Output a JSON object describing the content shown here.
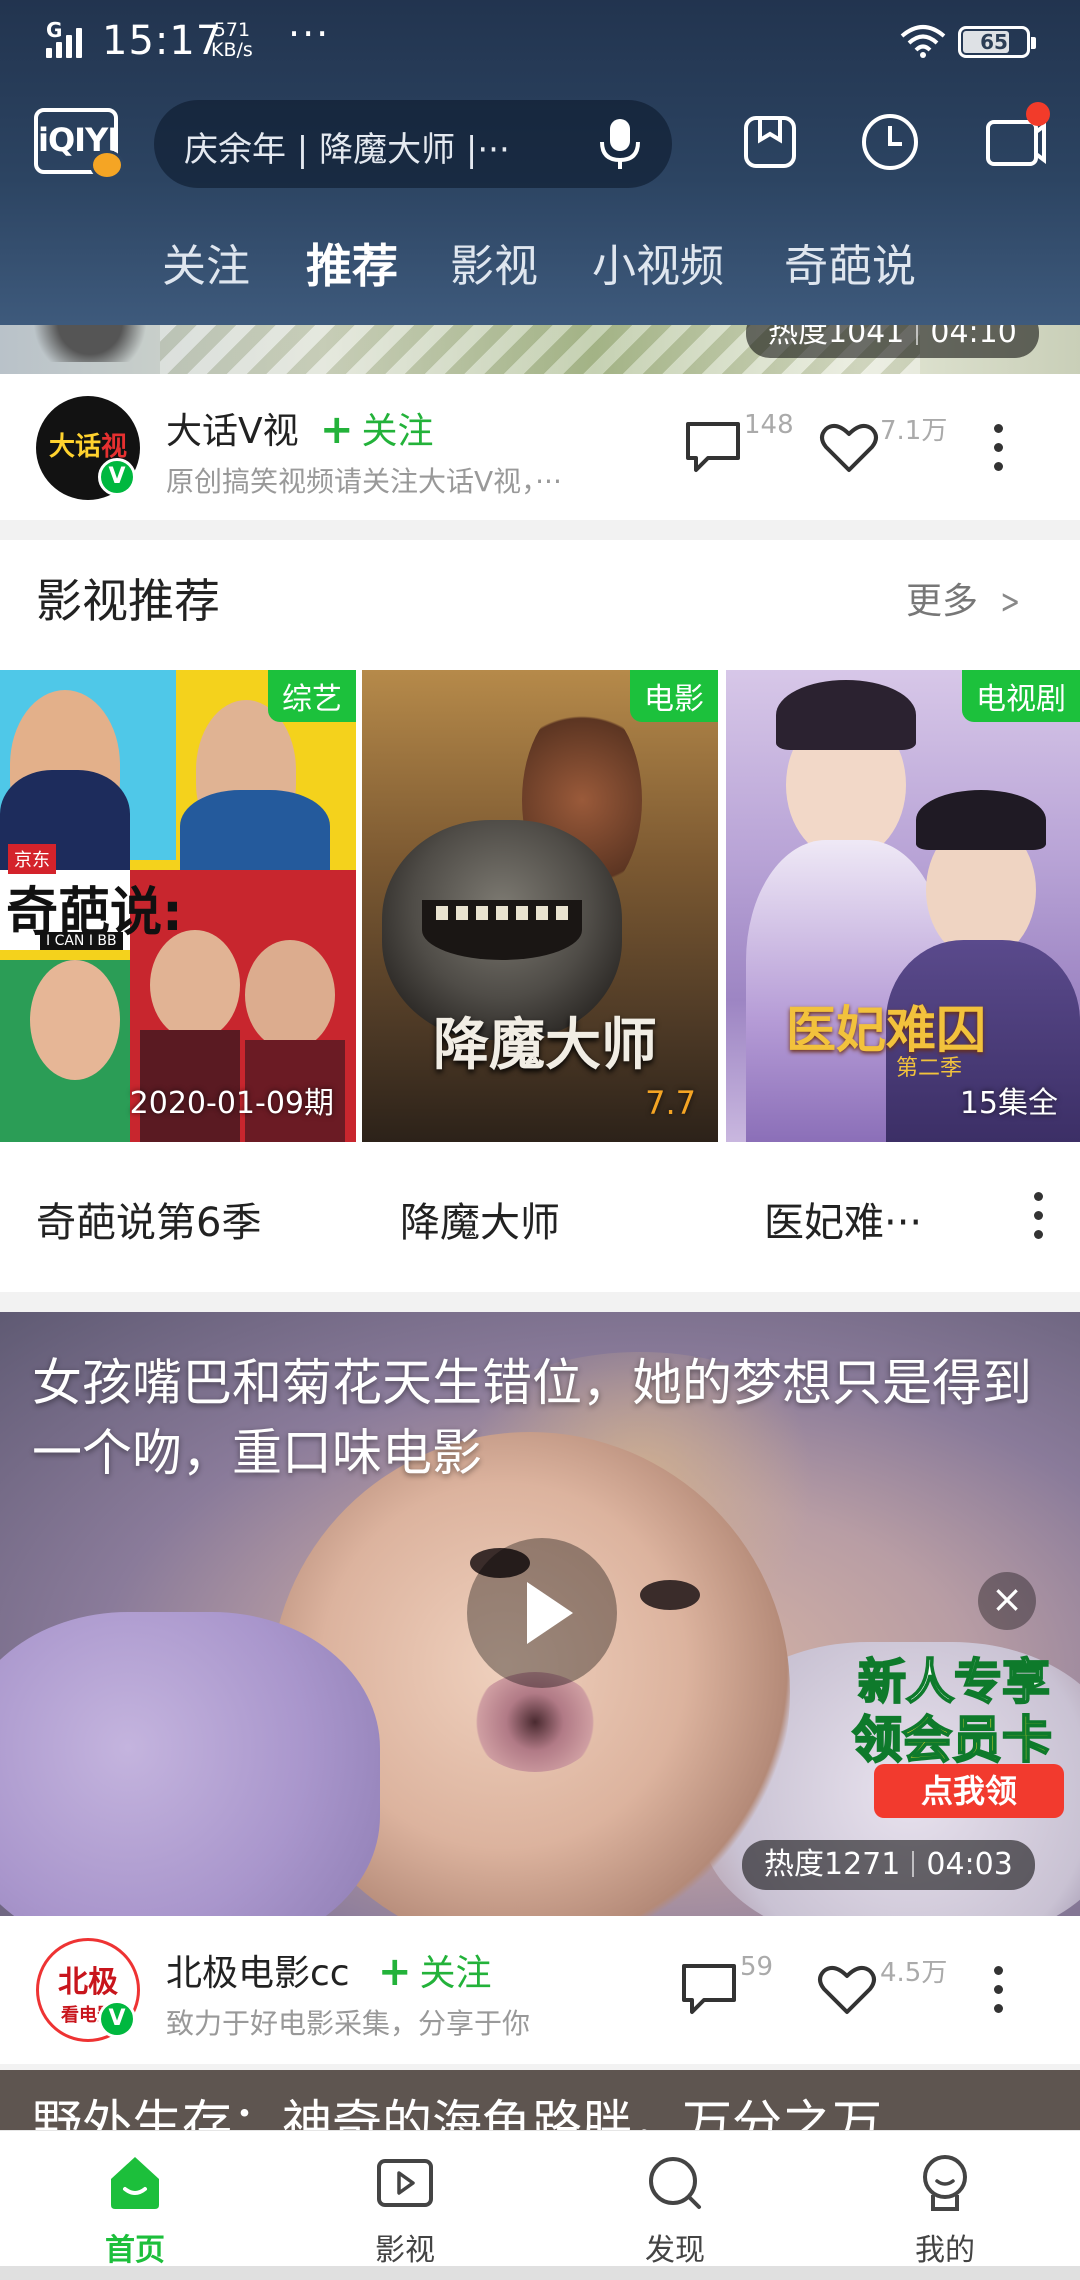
{
  "status_bar": {
    "network": "G",
    "time": "15:17",
    "speed_value": "571",
    "speed_unit": "KB/s",
    "more": "···",
    "battery": "65"
  },
  "header": {
    "logo": "iQIYI",
    "search_placeholder": "庆余年 | 降魔大师 |···",
    "icons": [
      "mic-icon",
      "bookmark-box-icon",
      "history-clock-icon",
      "message-icon"
    ],
    "tabs": [
      "关注",
      "推荐",
      "影视",
      "小视频",
      "奇葩说"
    ],
    "active_tab": "推荐"
  },
  "prev_video": {
    "heat": "热度1041",
    "duration": "04:10"
  },
  "author1": {
    "avatar_text": "大话",
    "avatar_text2": "视",
    "name": "大话V视",
    "follow_label": "关注",
    "follow_plus": "+",
    "desc": "原创搞笑视频请关注大话V视，···",
    "comments": "148",
    "likes": "7.1万"
  },
  "recommend": {
    "title": "影视推荐",
    "more_label": "更多",
    "items": [
      {
        "tag": "综艺",
        "corner": "2020-01-09期",
        "name": "奇葩说第6季",
        "poster_text": "奇葩说:",
        "poster_sub": "I CAN I BB",
        "poster_brand": "京东"
      },
      {
        "tag": "电影",
        "corner": "7.7",
        "name": "降魔大师",
        "poster_text": "降魔大师"
      },
      {
        "tag": "电视剧",
        "corner": "15集全",
        "name": "医妃难···",
        "poster_text": "医妃难囚",
        "poster_sub": "第二季"
      }
    ]
  },
  "video": {
    "title": "女孩嘴巴和菊花天生错位，她的梦想只是得到一个吻，重口味电影",
    "heat": "热度1271",
    "duration": "04:03",
    "close": "×",
    "promo_line1": "新人专享",
    "promo_line2": "领会员卡",
    "promo_button": "点我领"
  },
  "author2": {
    "avatar_text": "北极",
    "avatar_text2": "看电影",
    "name": "北极电影cc",
    "follow_label": "关注",
    "follow_plus": "+",
    "desc": "致力于好电影采集，分享于你",
    "comments": "59",
    "likes": "4.5万"
  },
  "next_video": {
    "title_partial": "野外生存：神奇的海龟路胖，万分之万"
  },
  "bottom_nav": {
    "items": [
      "首页",
      "影视",
      "发现",
      "我的"
    ],
    "active": "首页"
  },
  "colors": {
    "accent_green": "#1cbf3b",
    "header_bg": "#2c4462",
    "notify_red": "#f23b2a"
  }
}
